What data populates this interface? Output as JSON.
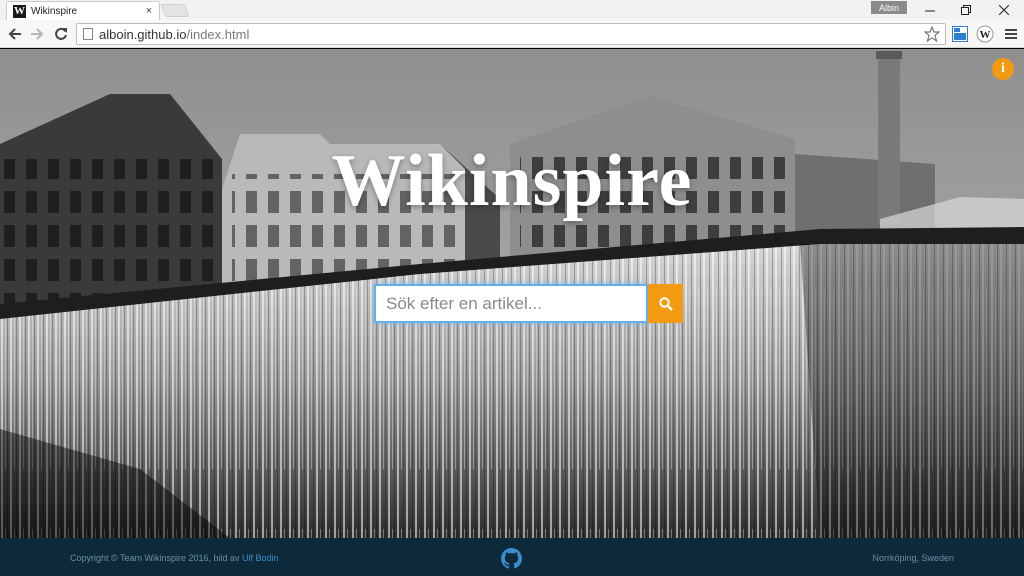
{
  "browser": {
    "tab_title": "Wikinspire",
    "tab_favicon": "W",
    "tab_close": "×",
    "profile_name": "Albin",
    "url_host": "alboin.github.io",
    "url_path": "/index.html",
    "extension_icon_label": "W"
  },
  "page": {
    "title": "Wikinspire",
    "info_icon_glyph": "i",
    "search": {
      "placeholder": "Sök efter en artikel...",
      "value": ""
    }
  },
  "footer": {
    "copyright_text": "Copyright © Team Wikinspire 2016, bild av ",
    "photographer_link": "Ulf Bodin",
    "location": "Norrköping, Sweden"
  },
  "colors": {
    "accent_orange": "#f39a12",
    "footer_bg": "#0d2a3a",
    "link_blue": "#3d8bd0",
    "input_focus": "#66afe9"
  },
  "icons": [
    "wikipedia-favicon-icon",
    "back-arrow-icon",
    "forward-arrow-icon",
    "reload-icon",
    "page-icon",
    "star-icon",
    "extension-icon",
    "wikipedia-extension-icon",
    "menu-icon",
    "info-icon",
    "search-icon",
    "github-icon"
  ]
}
